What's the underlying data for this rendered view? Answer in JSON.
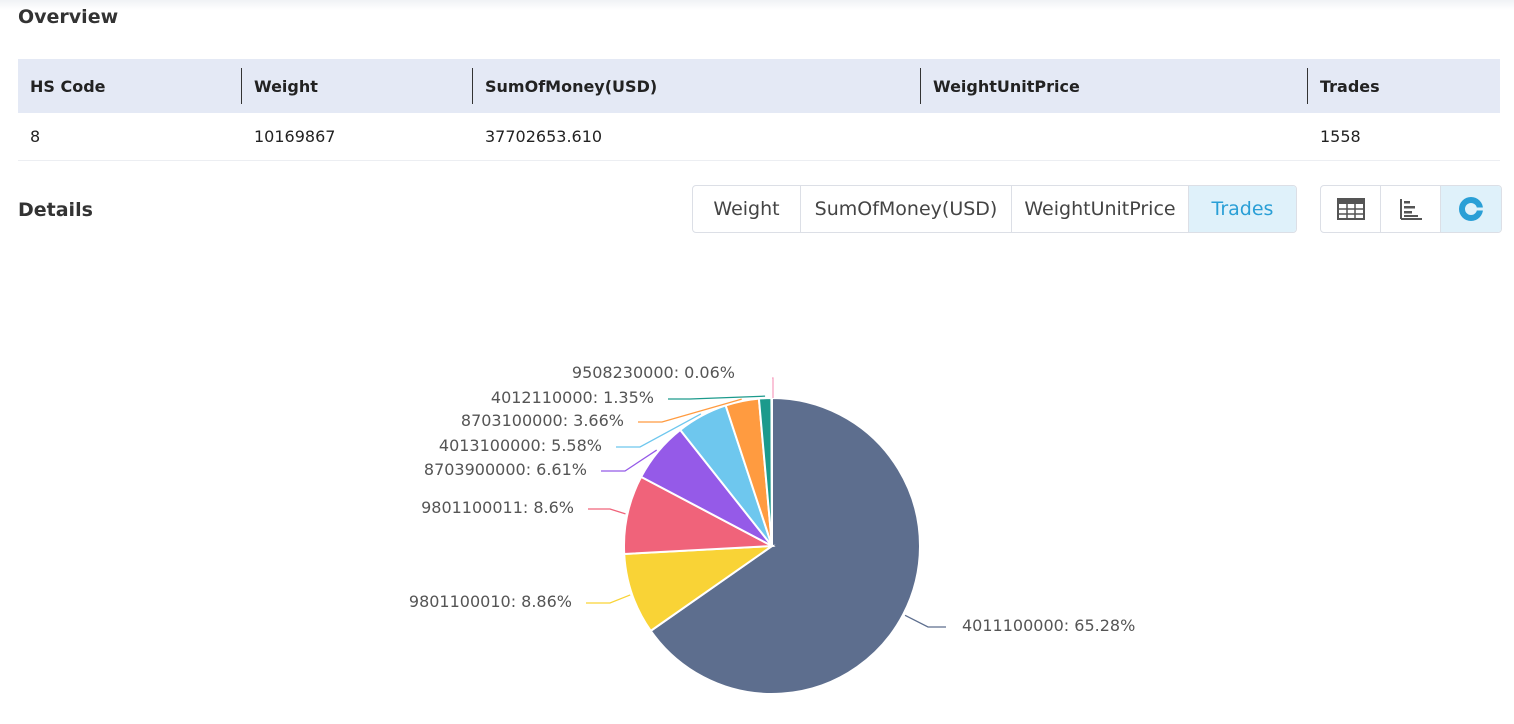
{
  "overview": {
    "title": "Overview",
    "headers": [
      "HS Code",
      "Weight",
      "SumOfMoney(USD)",
      "WeightUnitPrice",
      "Trades"
    ],
    "row": [
      "8",
      "10169867",
      "37702653.610",
      "",
      "1558"
    ]
  },
  "details": {
    "title": "Details",
    "tabs": [
      "Weight",
      "SumOfMoney(USD)",
      "WeightUnitPrice",
      "Trades"
    ],
    "active_tab": "Trades",
    "views": [
      {
        "icon": "table-icon"
      },
      {
        "icon": "bar-chart-icon"
      },
      {
        "icon": "pie-chart-icon",
        "active": true
      }
    ]
  },
  "chart_data": {
    "type": "pie",
    "slices": [
      {
        "label": "4011100000",
        "value": 65.28,
        "display": "4011100000: 65.28%",
        "color": "#5d6e8e"
      },
      {
        "label": "9801100010",
        "value": 8.86,
        "display": "9801100010: 8.86%",
        "color": "#f9d336"
      },
      {
        "label": "9801100011",
        "value": 8.6,
        "display": "9801100011: 8.6%",
        "color": "#f0637a"
      },
      {
        "label": "8703900000",
        "value": 6.61,
        "display": "8703900000: 6.61%",
        "color": "#955ae8"
      },
      {
        "label": "4013100000",
        "value": 5.58,
        "display": "4013100000: 5.58%",
        "color": "#6ec7ee"
      },
      {
        "label": "8703100000",
        "value": 3.66,
        "display": "8703100000: 3.66%",
        "color": "#ff9b40"
      },
      {
        "label": "4012110000",
        "value": 1.35,
        "display": "4012110000: 1.35%",
        "color": "#1c9a8c"
      },
      {
        "label": "9508230000",
        "value": 0.06,
        "display": "9508230000: 0.06%",
        "color": "#f7a5c2"
      }
    ]
  }
}
